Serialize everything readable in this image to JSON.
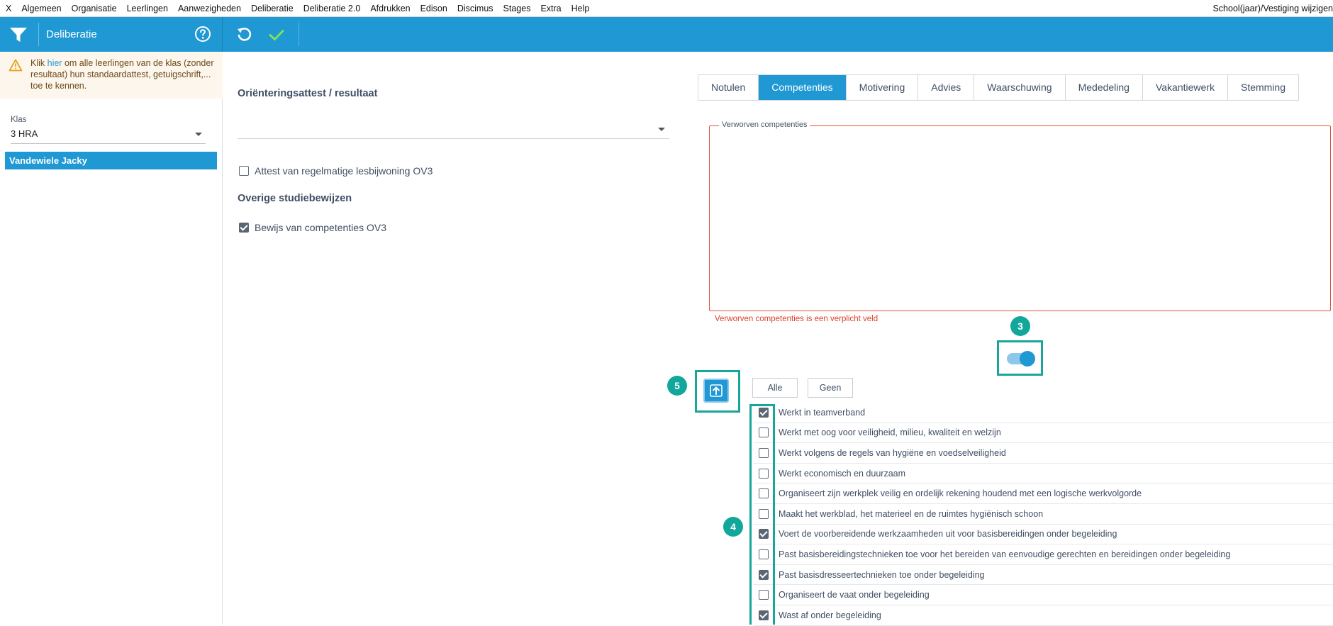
{
  "menubar": {
    "items": [
      "X",
      "Algemeen",
      "Organisatie",
      "Leerlingen",
      "Aanwezigheden",
      "Deliberatie",
      "Deliberatie 2.0",
      "Afdrukken",
      "Edison",
      "Discimus",
      "Stages",
      "Extra",
      "Help"
    ],
    "right_label": "School(jaar)/Vestiging wijzigen"
  },
  "header": {
    "title": "Deliberatie",
    "icons": [
      "filter-icon",
      "help-icon",
      "undo-icon",
      "check-icon"
    ],
    "accent_color": "#1f98d4"
  },
  "sidebar": {
    "warning": {
      "prefix": "Klik ",
      "link": "hier",
      "suffix": " om alle leerlingen van de klas (zonder resultaat) hun standaardattest, getuigschrift,... toe te kennen."
    },
    "klas_label": "Klas",
    "klas_value": "3 HRA",
    "students": [
      "Vandewiele Jacky"
    ]
  },
  "main": {
    "orient_title": "Oriënteringsattest / resultaat",
    "orient_value": "",
    "attest_label": "Attest van regelmatige lesbijwoning OV3",
    "attest_checked": false,
    "overige_title": "Overige studiebewijzen",
    "bewijs_label": "Bewijs van competenties OV3",
    "bewijs_checked": true
  },
  "tabs": [
    {
      "label": "Notulen",
      "active": false
    },
    {
      "label": "Competenties",
      "active": true
    },
    {
      "label": "Motivering",
      "active": false
    },
    {
      "label": "Advies",
      "active": false
    },
    {
      "label": "Waarschuwing",
      "active": false
    },
    {
      "label": "Mededeling",
      "active": false
    },
    {
      "label": "Vakantiewerk",
      "active": false
    },
    {
      "label": "Stemming",
      "active": false
    }
  ],
  "competenties": {
    "legend": "Verworven competenties",
    "value": "",
    "error": "Verworven competenties is een verplicht veld",
    "toggle_on": true,
    "alle_label": "Alle",
    "geen_label": "Geen",
    "items": [
      {
        "label": "Werkt in teamverband",
        "checked": true
      },
      {
        "label": "Werkt met oog voor veiligheid, milieu, kwaliteit en welzijn",
        "checked": false
      },
      {
        "label": "Werkt volgens de regels van hygiëne en voedselveiligheid",
        "checked": false
      },
      {
        "label": "Werkt economisch en duurzaam",
        "checked": false
      },
      {
        "label": "Organiseert zijn werkplek veilig en ordelijk rekening houdend met een logische werkvolgorde",
        "checked": false
      },
      {
        "label": "Maakt het werkblad, het materieel en de ruimtes hygiënisch schoon",
        "checked": false
      },
      {
        "label": "Voert de voorbereidende werkzaamheden uit voor basisbereidingen onder begeleiding",
        "checked": true
      },
      {
        "label": "Past basisbereidingstechnieken toe voor het bereiden van eenvoudige gerechten en bereidingen onder begeleiding",
        "checked": false
      },
      {
        "label": "Past basisdresseertechnieken toe onder begeleiding",
        "checked": true
      },
      {
        "label": "Organiseert de vaat onder begeleiding",
        "checked": false
      },
      {
        "label": "Wast af onder begeleiding",
        "checked": true
      }
    ]
  },
  "annotations": [
    "3",
    "4",
    "5"
  ]
}
